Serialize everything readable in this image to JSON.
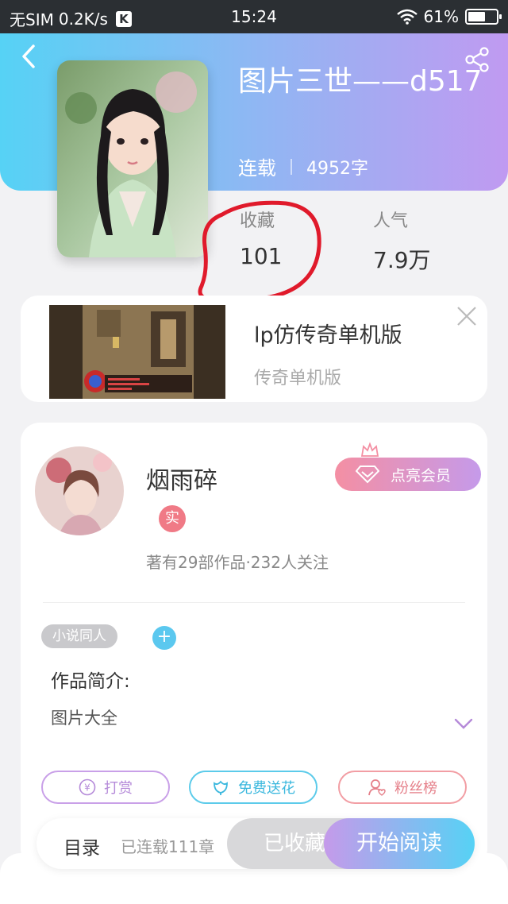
{
  "status_bar": {
    "carrier": "无SIM",
    "speed": "0.2K/s",
    "k_badge": "K",
    "time": "15:24",
    "battery": "61%",
    "battery_level": 0.61
  },
  "book": {
    "title": "图片三世——d517",
    "status": "连载",
    "word_count": "4952字",
    "favorites_label": "收藏",
    "favorites_value": "101",
    "popularity_label": "人气",
    "popularity_value": "7.9万"
  },
  "ad": {
    "title": "lp仿传奇单机版",
    "subtitle": "传奇单机版"
  },
  "author": {
    "name": "烟雨碎",
    "verified_badge": "实",
    "vip_button": "点亮会员",
    "stats": "著有29部作品·232人关注"
  },
  "tags": {
    "tag1": "小说同人",
    "add": "+"
  },
  "intro": {
    "label": "作品简介:",
    "text": "图片大全"
  },
  "actions": {
    "reward": "打赏",
    "reward_symbol": "¥",
    "flower": "免费送花",
    "fans": "粉丝榜"
  },
  "bottom_bar": {
    "toc": "目录",
    "chapters": "已连载111章",
    "favorited": "已收藏",
    "read": "开始阅读"
  },
  "colors": {
    "header_start": "#56d2f5",
    "header_end": "#c09af1",
    "annotation_red": "#e01a2b"
  },
  "icons": [
    "back-arrow-icon",
    "share-icon",
    "close-icon",
    "crown-icon",
    "diamond-icon",
    "yen-icon",
    "flower-icon",
    "user-icon",
    "chevron-down-icon",
    "wifi-icon",
    "battery-icon"
  ]
}
